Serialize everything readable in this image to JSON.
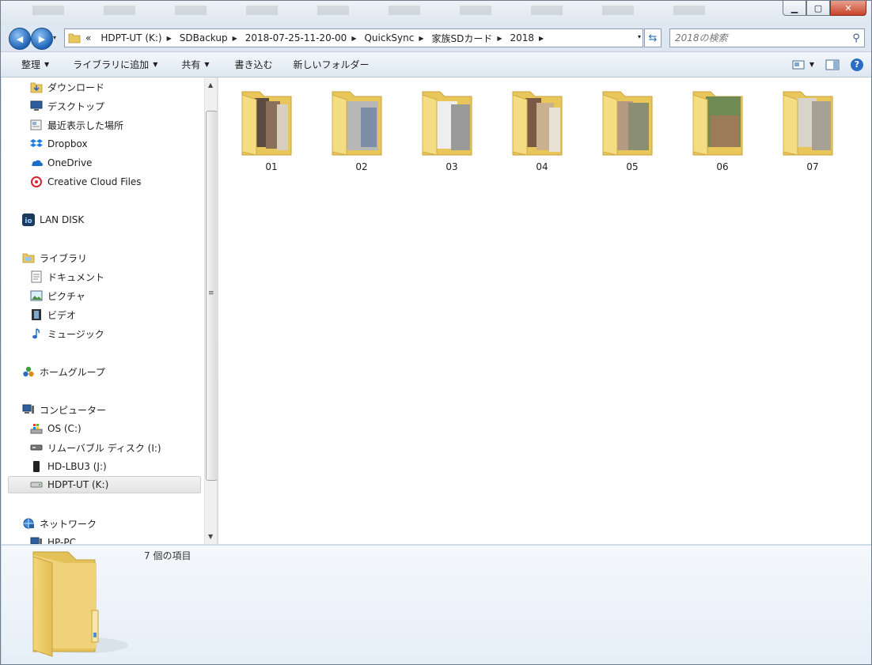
{
  "window": {
    "minimize": "▁",
    "maximize": "▢",
    "close": "✕"
  },
  "nav_buttons": {
    "back": "◀",
    "forward": "▶",
    "history": "▾"
  },
  "address": {
    "overflow": "«",
    "crumbs": [
      "HDPT-UT (K:)",
      "SDBackup",
      "2018-07-25-11-20-00",
      "QuickSync",
      "家族SDカード",
      "2018"
    ],
    "separator": "▶",
    "dropdown": "▾",
    "refresh": "⇆"
  },
  "search": {
    "placeholder": "2018の検索",
    "icon": "⚲"
  },
  "toolbar": {
    "organize": "整理",
    "add_to_library": "ライブラリに追加",
    "share": "共有",
    "burn": "書き込む",
    "new_folder": "新しいフォルダー",
    "arrow": "▼",
    "help": "?"
  },
  "sidebar": {
    "favorites": [
      {
        "label": "ダウンロード",
        "icon": "download-folder-icon"
      },
      {
        "label": "デスクトップ",
        "icon": "desktop-icon"
      },
      {
        "label": "最近表示した場所",
        "icon": "recent-places-icon"
      },
      {
        "label": "Dropbox",
        "icon": "dropbox-icon"
      },
      {
        "label": "OneDrive",
        "icon": "onedrive-icon"
      },
      {
        "label": "Creative Cloud Files",
        "icon": "creative-cloud-icon"
      }
    ],
    "lan_disk": "LAN DISK",
    "libraries": {
      "header": "ライブラリ",
      "items": [
        "ドキュメント",
        "ピクチャ",
        "ビデオ",
        "ミュージック"
      ]
    },
    "homegroup": "ホームグループ",
    "computer": {
      "header": "コンピューター",
      "items": [
        "OS (C:)",
        "リムーバブル ディスク (I:)",
        "HD-LBU3 (J:)",
        "HDPT-UT (K:)"
      ]
    },
    "network": {
      "header": "ネットワーク",
      "items": [
        "HP-PC"
      ]
    },
    "scroll": {
      "up": "▲",
      "down": "▼",
      "grip": "≡"
    }
  },
  "folders": [
    "01",
    "02",
    "03",
    "04",
    "05",
    "06",
    "07"
  ],
  "details": {
    "count": "7 個の項目"
  },
  "colors": {
    "folder_front": "#f5dd84",
    "folder_back": "#e8c65a",
    "selection": "#e5e5e5"
  }
}
